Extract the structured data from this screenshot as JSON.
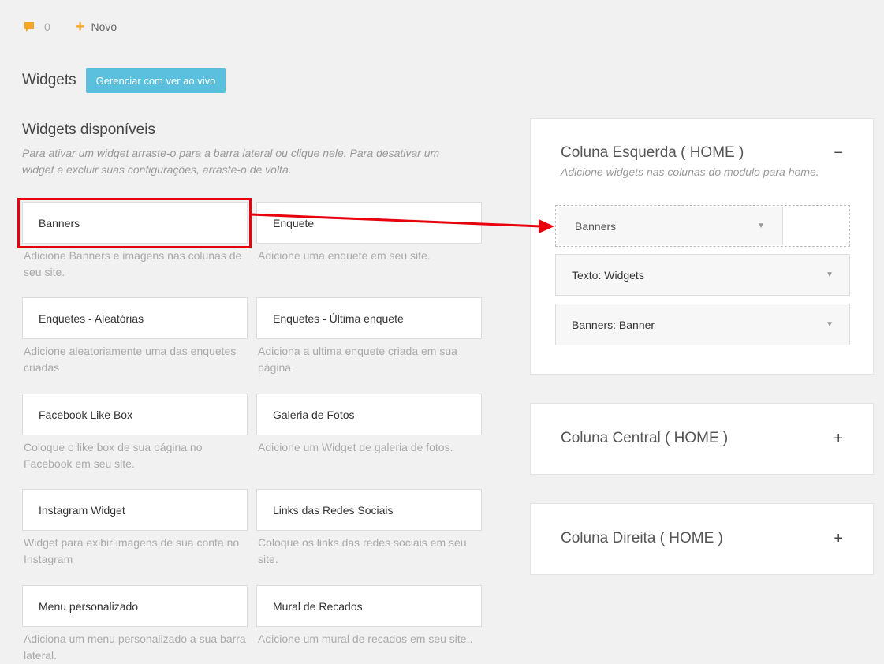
{
  "topbar": {
    "comment_count": "0",
    "new_label": "Novo"
  },
  "page": {
    "title": "Widgets",
    "manage_button": "Gerenciar com ver ao vivo"
  },
  "available": {
    "title": "Widgets disponíveis",
    "description": "Para ativar um widget arraste-o para a barra lateral ou clique nele. Para desativar um widget e excluir suas configurações, arraste-o de volta.",
    "widgets": [
      {
        "label": "Banners",
        "desc": "Adicione Banners e imagens nas colunas de seu site."
      },
      {
        "label": "Enquete",
        "desc": "Adicione uma enquete em seu site."
      },
      {
        "label": "Enquetes - Aleatórias",
        "desc": "Adicione aleatoriamente uma das enquetes criadas"
      },
      {
        "label": "Enquetes - Última enquete",
        "desc": "Adiciona a ultima enquete criada em sua página"
      },
      {
        "label": "Facebook Like Box",
        "desc": "Coloque o like box de sua página no Facebook em seu site."
      },
      {
        "label": "Galeria de Fotos",
        "desc": "Adicione um Widget de galeria de fotos."
      },
      {
        "label": "Instagram Widget",
        "desc": "Widget para exibir imagens de sua conta no Instagram"
      },
      {
        "label": "Links das Redes Sociais",
        "desc": "Coloque os links das redes sociais em seu site."
      },
      {
        "label": "Menu personalizado",
        "desc": "Adiciona um menu personalizado a sua barra lateral."
      },
      {
        "label": "Mural de Recados",
        "desc": "Adicione um mural de recados em seu site.."
      }
    ]
  },
  "columns": {
    "left": {
      "title": "Coluna Esquerda ( HOME )",
      "subtitle": "Adicione widgets nas colunas do modulo para home.",
      "toggle": "−",
      "dragging_widget": "Banners",
      "widgets": [
        "Texto: Widgets",
        "Banners: Banner"
      ]
    },
    "center": {
      "title": "Coluna Central ( HOME )",
      "toggle": "+"
    },
    "right": {
      "title": "Coluna Direita ( HOME )",
      "toggle": "+"
    }
  },
  "colors": {
    "accent": "#5bc0de",
    "highlight": "#e8000d",
    "icon_orange": "#f5a623"
  },
  "icons": {
    "comment": "comment-icon",
    "plus": "plus-icon",
    "caret": "caret-down-icon",
    "arrow": "arrow-right-annotation"
  }
}
